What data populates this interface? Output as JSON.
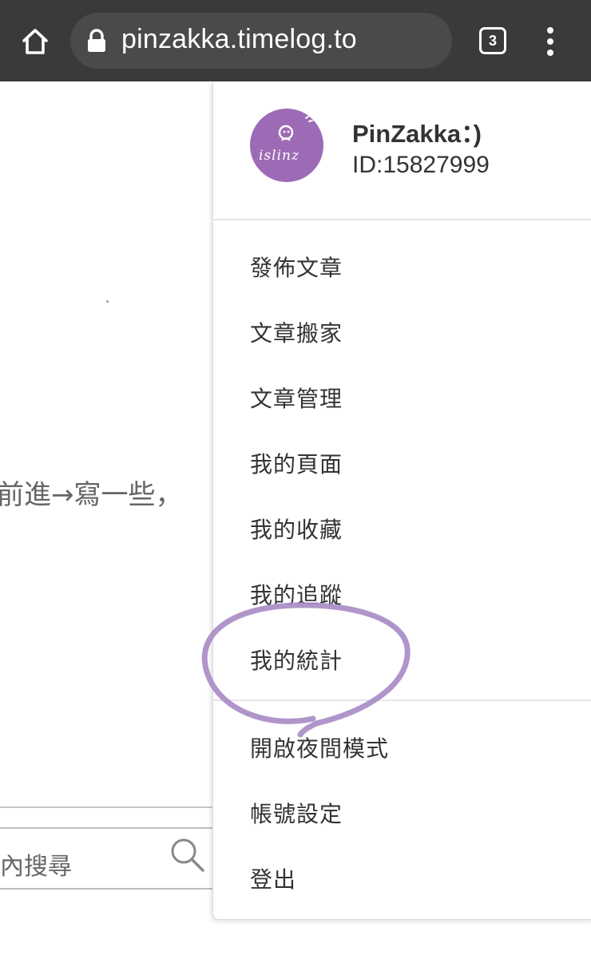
{
  "browser": {
    "url": "pinzakka.timelog.to",
    "tab_count": "3",
    "icons": {
      "home": "home-icon",
      "lock": "lock-icon",
      "tabs": "tabs-count-icon",
      "menu": "more-vert-icon"
    }
  },
  "background_page": {
    "text_fragment": "前進→寫一些，",
    "search_placeholder": "內搜尋"
  },
  "user": {
    "name": "PinZakka：)",
    "id": "ID:15827999",
    "avatar_text": "islinz",
    "avatar_color": "#9d6bb5"
  },
  "menu": {
    "items": [
      "發佈文章",
      "文章搬家",
      "文章管理",
      "我的頁面",
      "我的收藏",
      "我的追蹤",
      "我的統計"
    ],
    "settings": [
      "開啟夜間模式",
      "帳號設定",
      "登出"
    ]
  },
  "annotation": {
    "color": "#a98cc6"
  }
}
